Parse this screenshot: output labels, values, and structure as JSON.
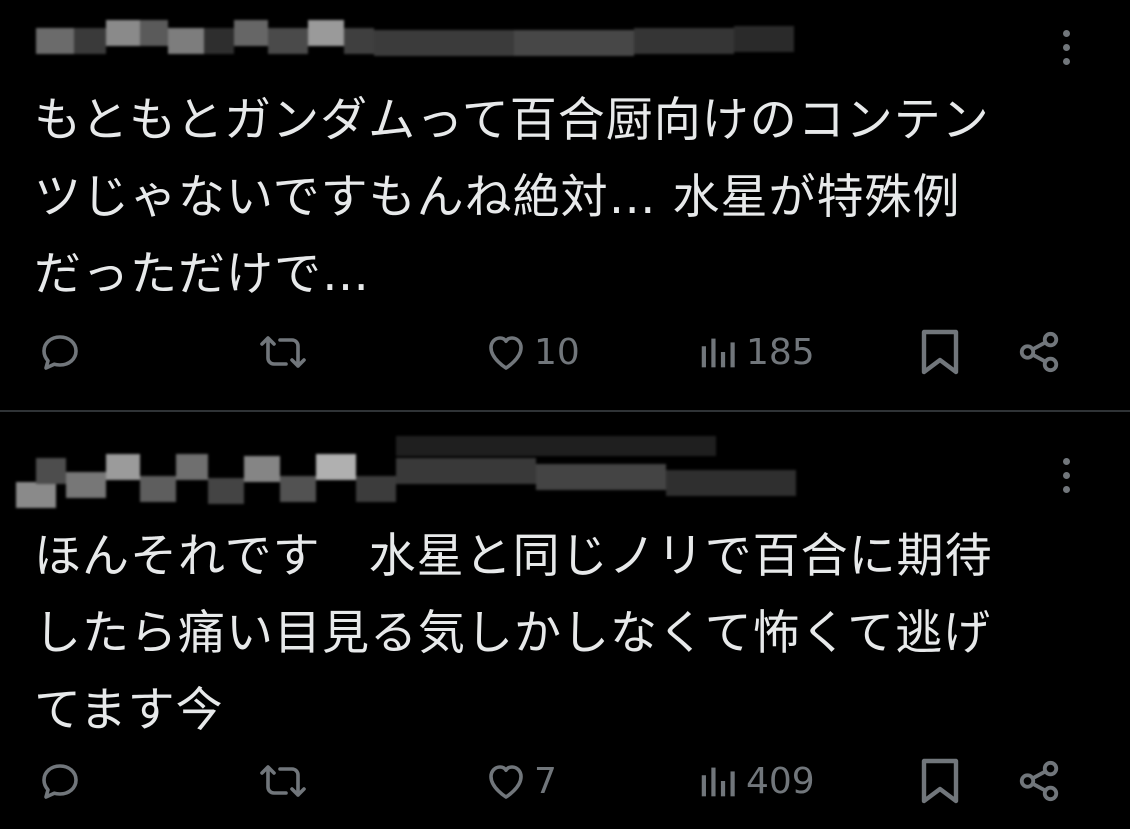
{
  "theme": {
    "background": "#000000",
    "text": "#e7e9ea",
    "muted": "#71767b",
    "divider": "#2f3336"
  },
  "posts": [
    {
      "author": "",
      "time": "",
      "text": "もともとガンダムって百合厨向けのコンテン\nツじゃないですもんね絶対… 水星が特殊例\nだっただけで…",
      "replies": "",
      "reposts": "",
      "likes": "10",
      "views": "185"
    },
    {
      "author": "",
      "time": "",
      "text": "ほんそれです　水星と同じノリで百合に期待\nしたら痛い目見る気しかしなくて怖くて逃げ\nてます今",
      "replies": "",
      "reposts": "",
      "likes": "7",
      "views": "409"
    }
  ],
  "icons": {
    "reply": "reply-icon",
    "repost": "repost-icon",
    "like": "heart-icon",
    "views": "views-chart-icon",
    "bookmark": "bookmark-icon",
    "share": "share-icon",
    "more": "more-vertical-icon"
  }
}
